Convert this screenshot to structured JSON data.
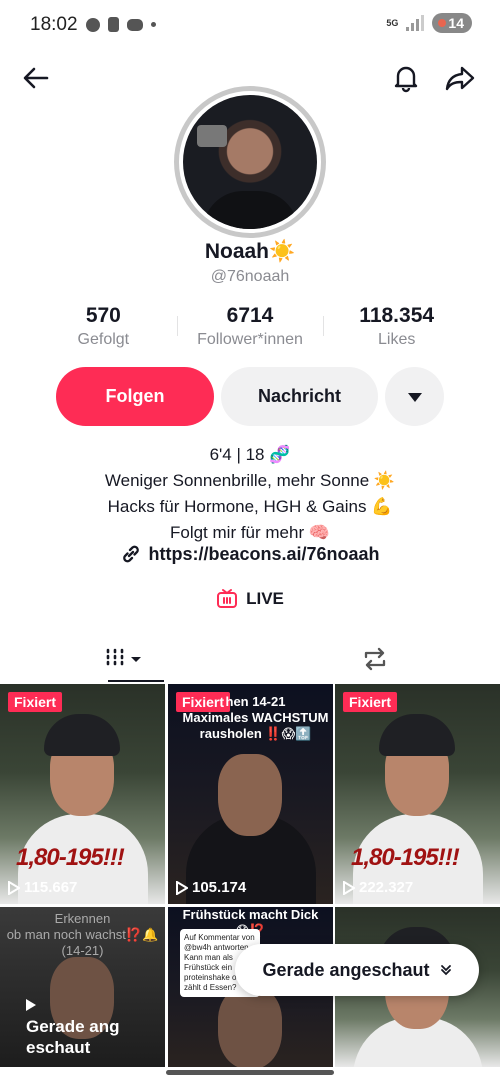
{
  "status_bar": {
    "time": "18:02",
    "network": "5G",
    "battery": "14"
  },
  "profile": {
    "name": "Noaah☀️",
    "handle": "@76noaah"
  },
  "stats": [
    {
      "value": "570",
      "label": "Gefolgt"
    },
    {
      "value": "6714",
      "label": "Follower*innen"
    },
    {
      "value": "118.354",
      "label": "Likes"
    }
  ],
  "actions": {
    "follow": "Folgen",
    "message": "Nachricht"
  },
  "bio": {
    "lines": [
      "6'4 | 18 🧬",
      "Weniger Sonnenbrille, mehr Sonne ☀️",
      "Hacks für Hormone, HGH & Gains 💪",
      "Folgt mir für mehr 🧠"
    ],
    "link": "https://beacons.ai/76noaah",
    "live": "LIVE"
  },
  "videos": [
    {
      "pinned": "Fixiert",
      "overlay": "1,80-195!!!",
      "views": "115.667"
    },
    {
      "pinned": "Fixiert",
      "caption": "hen 14-21\nMaximales WACHSTUM\nrausholen ‼️😱🔝",
      "views": "105.174"
    },
    {
      "pinned": "Fixiert",
      "overlay": "1,80-195!!!",
      "views": "222.327"
    },
    {
      "caption_top": "Erkennen\nob man noch wachst⁉️🔔\n(14-21)",
      "recently_viewed": "Gerade ang\neschaut"
    },
    {
      "caption_top": "Frühstück macht Dick😱⁉️",
      "comment": "Auf Kommentar von @bw4h antworten\nKann man als Frühstück ein proteinshake oder zählt d Essen?"
    },
    {}
  ],
  "toast": {
    "label": "Gerade angeschaut"
  }
}
